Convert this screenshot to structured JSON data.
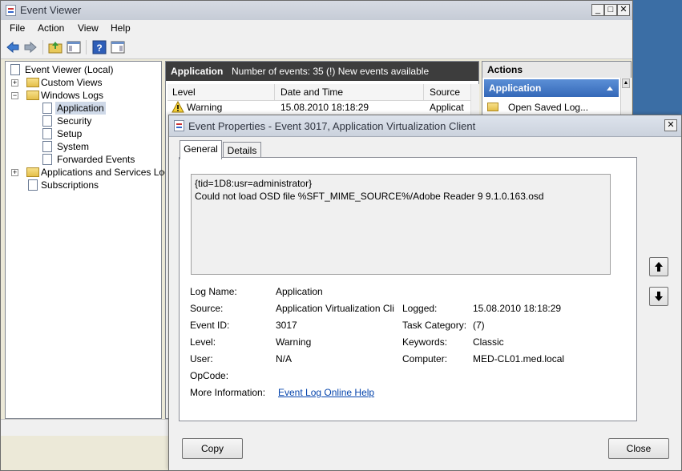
{
  "main_window": {
    "title": "Event Viewer",
    "minimize": "_",
    "maximize": "□",
    "close": "✕",
    "menu": [
      "File",
      "Action",
      "View",
      "Help"
    ]
  },
  "tree": {
    "root": "Event Viewer (Local)",
    "custom_views": "Custom Views",
    "windows_logs": "Windows Logs",
    "logs": [
      "Application",
      "Security",
      "Setup",
      "System",
      "Forwarded Events"
    ],
    "app_services": "Applications and Services Logs",
    "subscriptions": "Subscriptions"
  },
  "center": {
    "header_title": "Application",
    "header_info": "Number of events: 35 (!) New events available",
    "columns": [
      "Level",
      "Date and Time",
      "Source"
    ],
    "row": {
      "level": "Warning",
      "datetime": "15.08.2010 18:18:29",
      "source": "Applicat"
    }
  },
  "actions": {
    "header": "Actions",
    "section": "Application",
    "item": "Open Saved Log..."
  },
  "dialog": {
    "title": "Event Properties - Event 3017, Application Virtualization Client",
    "close": "✕",
    "tabs": [
      "General",
      "Details"
    ],
    "description_line1": "{tid=1D8:usr=administrator}",
    "description_line2": "Could not load OSD file %SFT_MIME_SOURCE%/Adobe Reader 9 9.1.0.163.osd",
    "fields": {
      "log_name_label": "Log Name:",
      "log_name": "Application",
      "source_label": "Source:",
      "source": "Application Virtualization Cli",
      "logged_label": "Logged:",
      "logged": "15.08.2010 18:18:29",
      "event_id_label": "Event ID:",
      "event_id": "3017",
      "task_category_label": "Task Category:",
      "task_category": "(7)",
      "level_label": "Level:",
      "level": "Warning",
      "keywords_label": "Keywords:",
      "keywords": "Classic",
      "user_label": "User:",
      "user": "N/A",
      "computer_label": "Computer:",
      "computer": "MED-CL01.med.local",
      "opcode_label": "OpCode:",
      "opcode": "",
      "more_info_label": "More Information:",
      "more_info_link": "Event Log Online Help"
    },
    "copy_button": "Copy",
    "close_button": "Close",
    "up_arrow": "🡅",
    "down_arrow": "🡇"
  }
}
